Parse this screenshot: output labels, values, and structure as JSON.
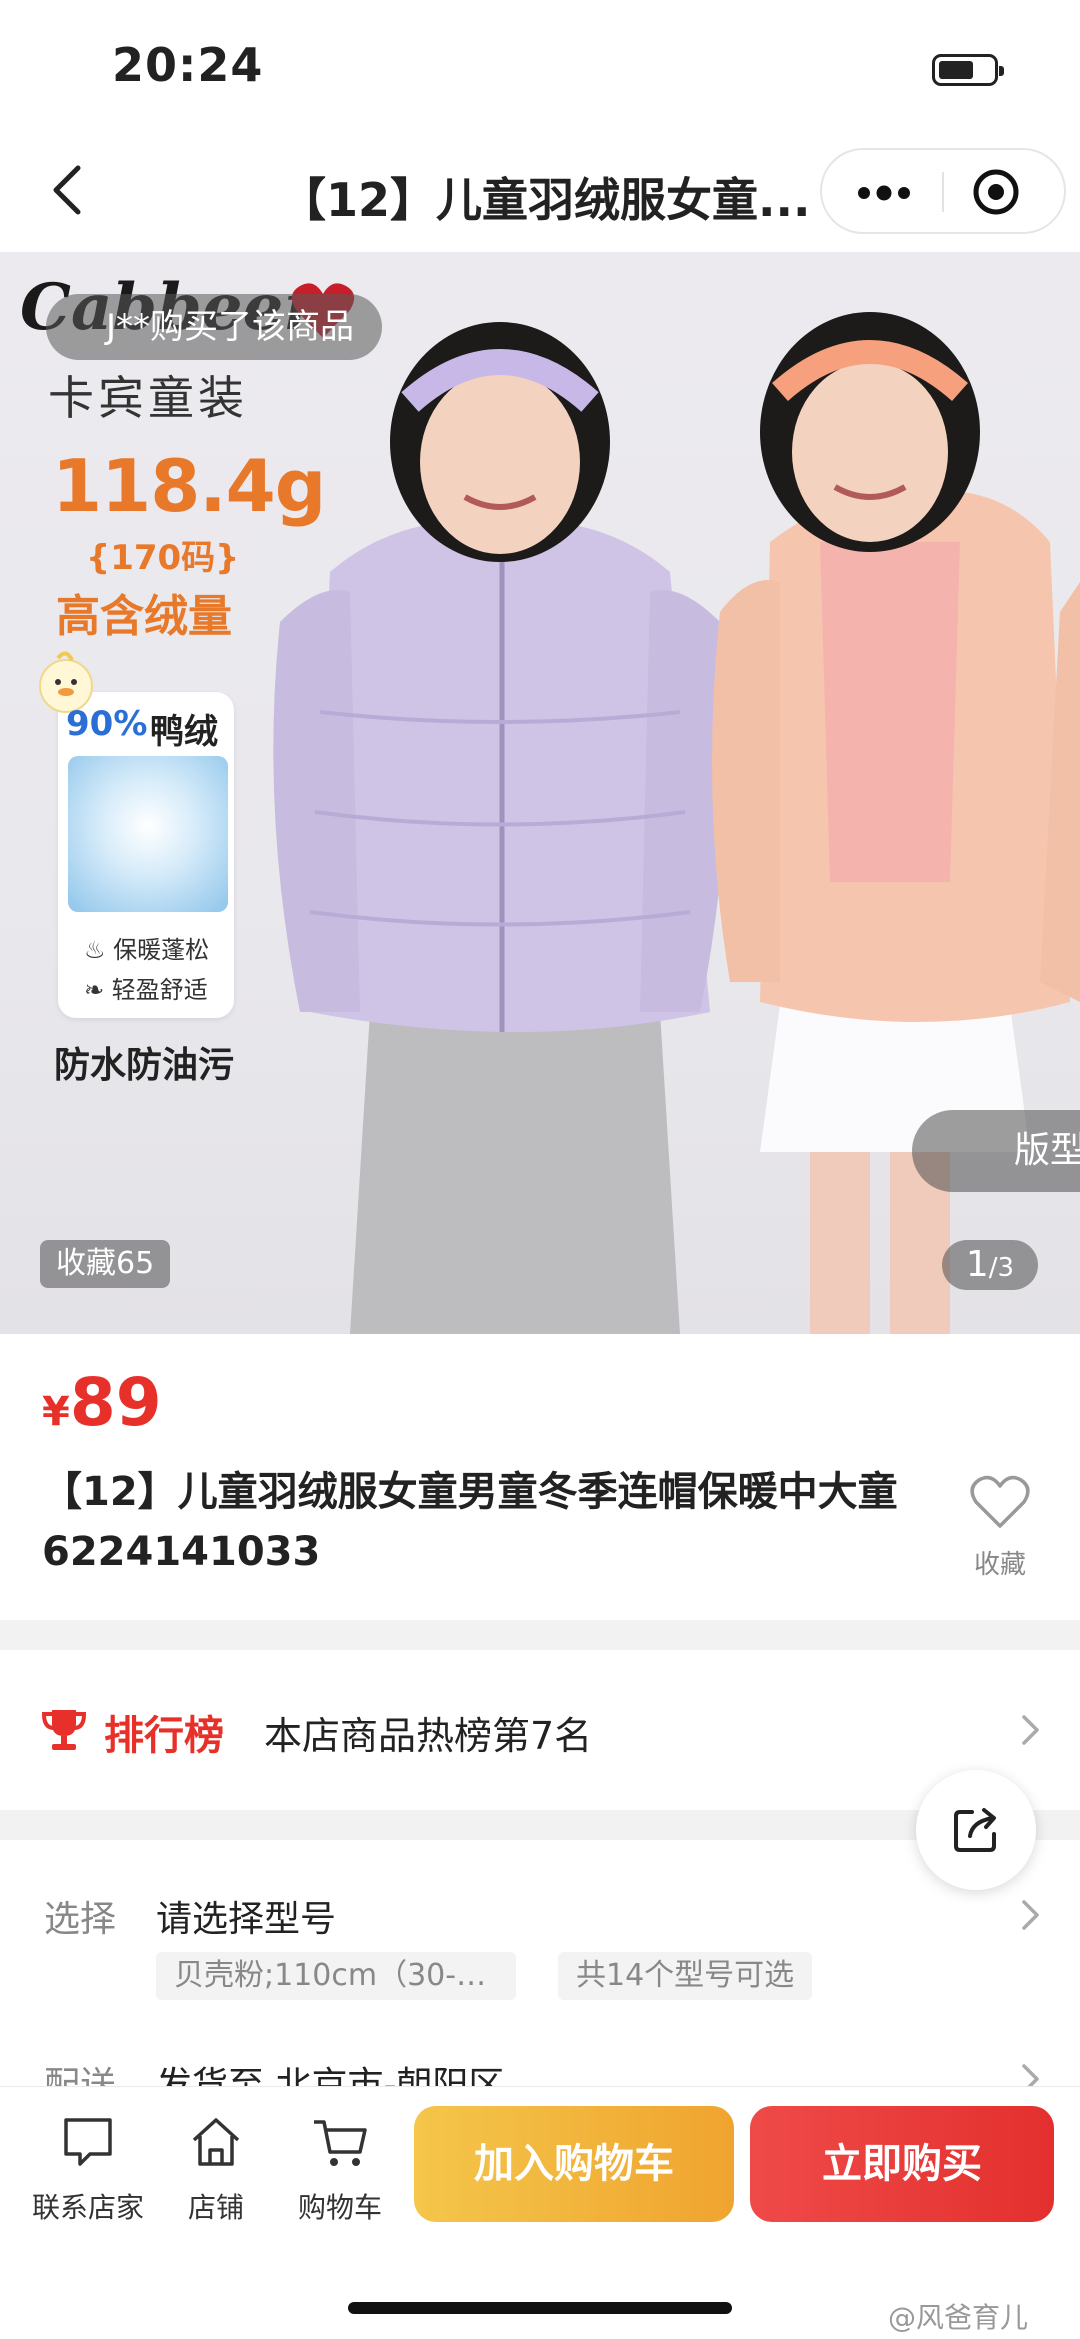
{
  "status": {
    "time": "20:24"
  },
  "nav": {
    "title": "【12】儿童羽绒服女童..."
  },
  "hero": {
    "buyer_toast": "J**购买了该商品",
    "brand_logo": "Cabbeen",
    "brand_cn": "卡宾童装",
    "weight": "118.4g",
    "size_note": "{170码}",
    "fill_note": "高含绒量",
    "down_pct": "90%",
    "down_txt": "鸭绒",
    "feature_1": "保暖蓬松",
    "feature_2": "轻盈舒适",
    "waterproof": "防水防油污",
    "version_tab": "版型",
    "favorites_badge": "收藏65",
    "pager_current": "1",
    "pager_total": "/3"
  },
  "product": {
    "currency": "¥",
    "price": "89",
    "title": "【12】儿童羽绒服女童男童冬季连帽保暖中大童6224141033",
    "fav_label": "收藏"
  },
  "rank": {
    "title": "排行榜",
    "desc": "本店商品热榜第7名"
  },
  "options": {
    "select_label": "选择",
    "select_value": "请选择型号",
    "chip_1": "贝壳粉;110cm（30-3...",
    "chip_2": "共14个型号可选",
    "ship_label": "配送",
    "ship_value": "发货至 北京市-朝阳区"
  },
  "bottom_bar": {
    "contact": "联系店家",
    "store": "店铺",
    "cart": "购物车",
    "add_to_cart": "加入购物车",
    "buy_now": "立即购买"
  },
  "watermark": "@风爸育儿",
  "colors": {
    "accent_red": "#e7302a",
    "cart_yellow": "#f0a42f",
    "orange_text": "#e8782a"
  }
}
